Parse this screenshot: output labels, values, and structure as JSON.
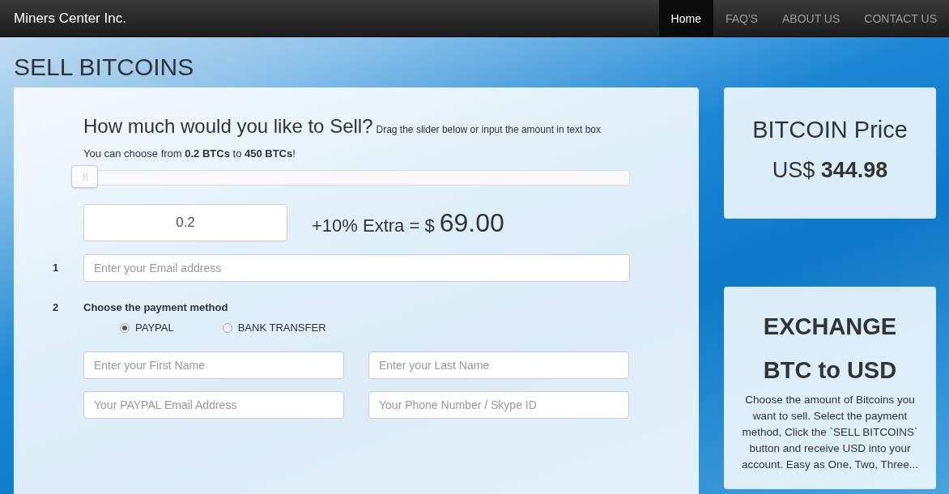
{
  "navbar": {
    "brand": "Miners Center Inc.",
    "links": [
      {
        "label": "Home",
        "selected": true
      },
      {
        "label": "FAQ'S",
        "selected": false
      },
      {
        "label": "ABOUT US",
        "selected": false
      },
      {
        "label": "CONTACT US",
        "selected": false
      }
    ]
  },
  "page_title": "SELL BITCOINS",
  "sell_form": {
    "heading": "How much would you like to Sell?",
    "hint": "Drag the slider below or input the amount in text box",
    "range_note": "You can choose from **0.2 BTCs** to **450 BTCs**!",
    "slider": {
      "level": 0
    },
    "amount": "0.2",
    "extra_label": "+10% Extra = $",
    "extra_value": "69.00",
    "email_step": {
      "number": "1",
      "placeholder": "Enter your Email address"
    },
    "payment_step": {
      "number": "2",
      "label": "Choose the payment method",
      "options": [
        {
          "label": "PAYPAL",
          "selected": true
        },
        {
          "label": "BANK TRANSFER",
          "selected": false
        }
      ],
      "fields": [
        {
          "placeholder": "Enter your First Name"
        },
        {
          "placeholder": "Enter your Last Name"
        },
        {
          "placeholder": "Your PAYPAL Email Address"
        },
        {
          "placeholder": "Your Phone Number / Skype ID"
        }
      ]
    }
  },
  "price_card": {
    "title": "BITCOIN Price",
    "price": "US$ **344.98**"
  },
  "exchange_card": {
    "title": "EXCHANGE BTC to USD",
    "text": "Choose the amount of Bitcoins you want to sell. Select the payment method, Click the `SELL BITCOINS` button and receive USD into your account. Easy as One, Two, Three..."
  }
}
